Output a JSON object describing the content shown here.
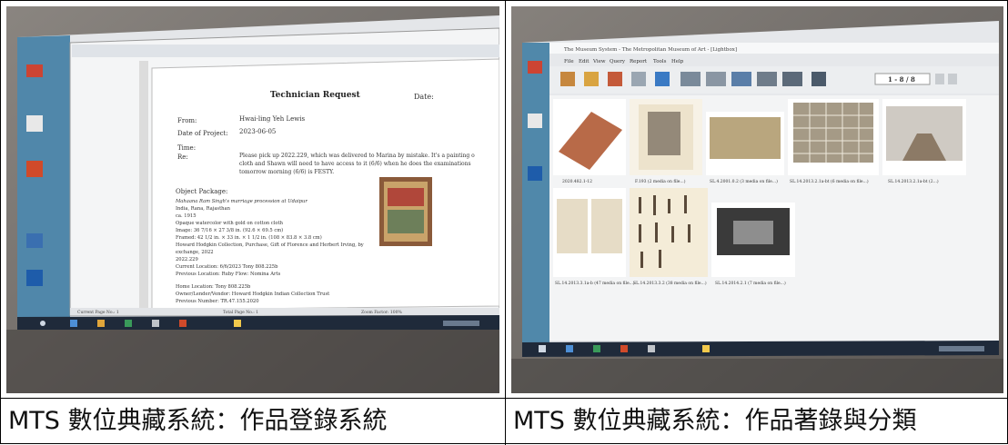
{
  "captions": {
    "left": "MTS 數位典藏系統：作品登錄系統",
    "right": "MTS 數位典藏系統：作品著錄與分類"
  },
  "left_photo": {
    "document": {
      "title": "Technician Request",
      "date_label": "Date:",
      "from_label": "From:",
      "from_value": "Hwai-ling Yeh Lewis",
      "project_label": "Date of Project:",
      "project_value": "2023-06-05",
      "time_label": "Time:",
      "re_label": "Re:",
      "re_lines": [
        "Please pick up 2022.229, which was delivered to Marina by mistake. It's a painting o",
        "cloth and Shawn will need to have access to it (6/6) when he does the examinations",
        "tomorrow morning (6/6) is FESTY."
      ],
      "package_heading": "Object Package:",
      "package_lines": [
        "Mahaana Ram Singh's marriage procession at Udaipur",
        "India, Rana, Rajasthan",
        "ca. 1915",
        "Opaque watercolor with gold on cotton cloth",
        "Image: 36 7/16 × 27 3/8 in. (92.6 × 69.5 cm)",
        "Framed: 42 1/2 in. × 33 in. × 1 1/2 in. (108 × 83.8 × 3.8 cm)",
        "Howard Hodgkin Collection, Purchase, Gift of Florence and Herbert Irving, by",
        "exchange, 2022",
        "2022.229",
        "Current Location: 6/6/2023 Tony 808.225b",
        "Previous Location: Ruby Flow: Nomina Arts"
      ],
      "home_lines": [
        "Home Location: Tony 808.225b",
        "Owner/Lender/Vendor: Howard Hodgkin Indian Collection Trust",
        "Previous Number: TR.47.155.2020"
      ],
      "status_page": "Current Page No.: 1",
      "status_total": "Total Page No.: 1",
      "status_zoom": "Zoom Factor: 100%"
    }
  },
  "right_photo": {
    "window_title": "The Museum System - The Metropolitan Museum of Art - [Lightbox]",
    "menu": [
      "File",
      "Edit",
      "View",
      "Query",
      "Report",
      "Tools",
      "Help"
    ],
    "record_counter": "1 - 8 / 8",
    "thumb_captions": [
      "2020.482.1-12",
      "F.193 (2 media on file...)",
      "SL.4.2001.0.2 (3 media on file...)",
      "SL.14.2013.2.1a-bt (6 media on file...)",
      "SL.14.2013.2.1a-bt (2...)",
      "SL.14.2013.3.1a-b (47 media on file...)",
      "SL.14.2013.3.2 (38 media on file...)",
      "SL.14.2014.2.1 (7 media on file...)"
    ]
  },
  "colors": {
    "projection_wall": "#6e6a66",
    "screen_white": "#eceff1",
    "taskbar": "#1f2a3a",
    "frame_brown": "#8a5a3a",
    "thumb_book": "#b86a48"
  }
}
